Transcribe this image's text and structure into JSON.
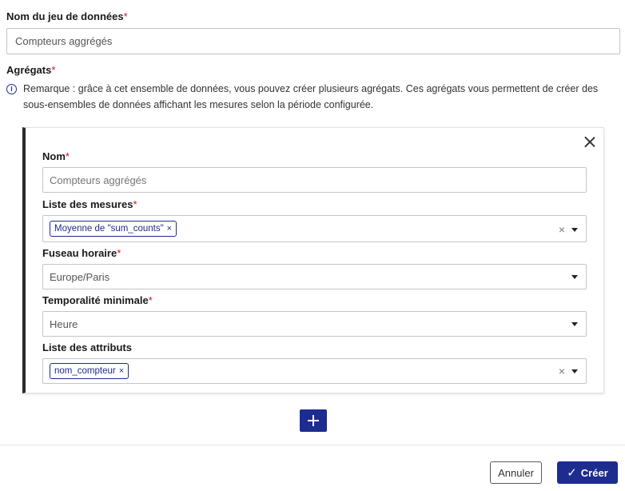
{
  "dataset": {
    "label": "Nom du jeu de données",
    "required_mark": "*",
    "value": "Compteurs aggrégés"
  },
  "aggregates": {
    "label": "Agrégats",
    "required_mark": "*",
    "note_icon": "info-icon",
    "note": "Remarque : grâce à cet ensemble de données, vous pouvez créer plusieurs agrégats. Ces agrégats vous permettent de créer des sous-ensembles de données affichant les mesures selon la période configurée."
  },
  "card": {
    "close_icon": "close-icon",
    "name": {
      "label": "Nom",
      "required_mark": "*",
      "placeholder": "Compteurs aggrégés"
    },
    "measures": {
      "label": "Liste des mesures",
      "required_mark": "*",
      "chips": [
        "Moyenne de \"sum_counts\""
      ],
      "chip_remove": "×",
      "clear": "×"
    },
    "timezone": {
      "label": "Fuseau horaire",
      "required_mark": "*",
      "value": "Europe/Paris"
    },
    "temporality": {
      "label": "Temporalité minimale",
      "required_mark": "*",
      "value": "Heure"
    },
    "attributes": {
      "label": "Liste des attributs",
      "chips": [
        "nom_compteur"
      ],
      "chip_remove": "×",
      "clear": "×"
    }
  },
  "actions": {
    "add_icon": "plus-icon",
    "cancel_label": "Annuler",
    "create_label": "Créer",
    "create_icon": "✓"
  },
  "colors": {
    "primary": "#1d2c8f",
    "required": "#c8102e",
    "card_accent": "#2b2b2b"
  }
}
